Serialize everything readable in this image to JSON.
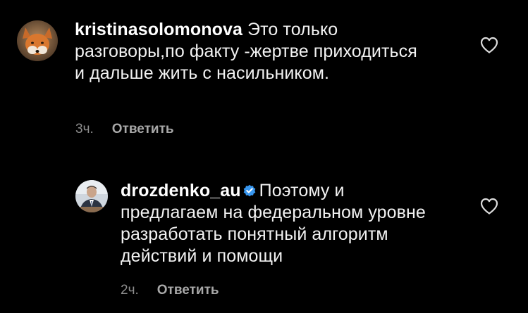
{
  "comments": [
    {
      "username": "kristinasolomonova",
      "text": "Это только разговоры,по факту -жертве приходиться и дальше жить с насильником.",
      "time": "3ч.",
      "reply_label": "Ответить",
      "avatar_icon": "fox-avatar",
      "like_icon": "heart-outline-icon"
    },
    {
      "username": "drozdenko_au",
      "verified": true,
      "text": "Поэтому и предлагаем на федеральном уровне разработать понятный алгоритм действий и помощи",
      "time": "2ч.",
      "reply_label": "Ответить",
      "avatar_icon": "person-avatar",
      "like_icon": "heart-outline-icon"
    }
  ],
  "colors": {
    "background": "#000000",
    "text": "#f2f2f2",
    "meta": "#8e8e8e",
    "verified": "#3897f0"
  }
}
